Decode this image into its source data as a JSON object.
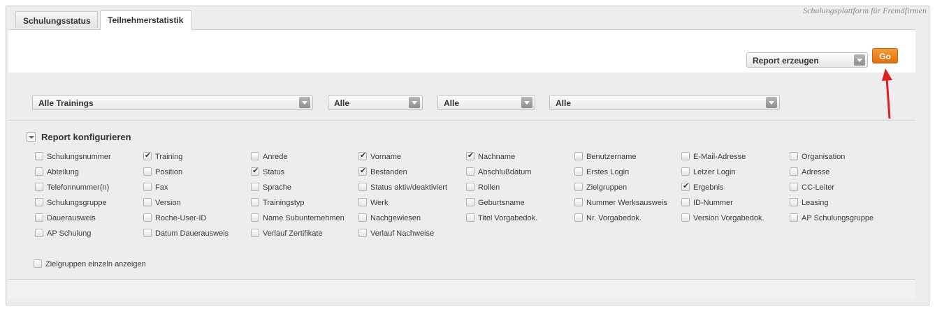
{
  "brand": "Schulungsplattform für Fremdfirmen",
  "tabs": [
    {
      "label": "Schulungsstatus",
      "active": false
    },
    {
      "label": "Teilnehmerstatistik",
      "active": true
    }
  ],
  "toolbar": {
    "report_select": "Report erzeugen",
    "go_label": "Go"
  },
  "filters": {
    "training": "Alle Trainings",
    "filter2": "Alle",
    "filter3": "Alle",
    "filter4": "Alle"
  },
  "config": {
    "title": "Report konfigurieren",
    "options": [
      {
        "label": "Schulungsnummer",
        "checked": false
      },
      {
        "label": "Training",
        "checked": true
      },
      {
        "label": "Anrede",
        "checked": false
      },
      {
        "label": "Vorname",
        "checked": true
      },
      {
        "label": "Nachname",
        "checked": true
      },
      {
        "label": "Benutzername",
        "checked": false
      },
      {
        "label": "E-Mail-Adresse",
        "checked": false
      },
      {
        "label": "Organisation",
        "checked": false
      },
      {
        "label": "Abteilung",
        "checked": false
      },
      {
        "label": "Position",
        "checked": false
      },
      {
        "label": "Status",
        "checked": true
      },
      {
        "label": "Bestanden",
        "checked": true
      },
      {
        "label": "Abschlußdatum",
        "checked": false
      },
      {
        "label": "Erstes Login",
        "checked": false
      },
      {
        "label": "Letzer Login",
        "checked": false
      },
      {
        "label": "Adresse",
        "checked": false
      },
      {
        "label": "Telefonnummer(n)",
        "checked": false
      },
      {
        "label": "Fax",
        "checked": false
      },
      {
        "label": "Sprache",
        "checked": false
      },
      {
        "label": "Status aktiv/deaktiviert",
        "checked": false
      },
      {
        "label": "Rollen",
        "checked": false
      },
      {
        "label": "Zielgruppen",
        "checked": false
      },
      {
        "label": "Ergebnis",
        "checked": true
      },
      {
        "label": "CC-Leiter",
        "checked": false
      },
      {
        "label": "Schulungsgruppe",
        "checked": false
      },
      {
        "label": "Version",
        "checked": false
      },
      {
        "label": "Trainingstyp",
        "checked": false
      },
      {
        "label": "Werk",
        "checked": false
      },
      {
        "label": "Geburtsname",
        "checked": false
      },
      {
        "label": "Nummer Werksausweis",
        "checked": false
      },
      {
        "label": "ID-Nummer",
        "checked": false
      },
      {
        "label": "Leasing",
        "checked": false
      },
      {
        "label": "Dauerausweis",
        "checked": false
      },
      {
        "label": "Roche-User-ID",
        "checked": false
      },
      {
        "label": "Name Subunternehmen",
        "checked": false
      },
      {
        "label": "Nachgewiesen",
        "checked": false
      },
      {
        "label": "Titel Vorgabedok.",
        "checked": false
      },
      {
        "label": "Nr. Vorgabedok.",
        "checked": false
      },
      {
        "label": "Version Vorgabedok.",
        "checked": false
      },
      {
        "label": "AP Schulungsgruppe",
        "checked": false
      },
      {
        "label": "AP Schulung",
        "checked": false
      },
      {
        "label": "Datum Dauerausweis",
        "checked": false
      },
      {
        "label": "Verlauf Zertifikate",
        "checked": false
      },
      {
        "label": "Verlauf Nachweise",
        "checked": false
      }
    ],
    "extra": {
      "label": "Zielgruppen einzeln anzeigen",
      "checked": false
    }
  }
}
